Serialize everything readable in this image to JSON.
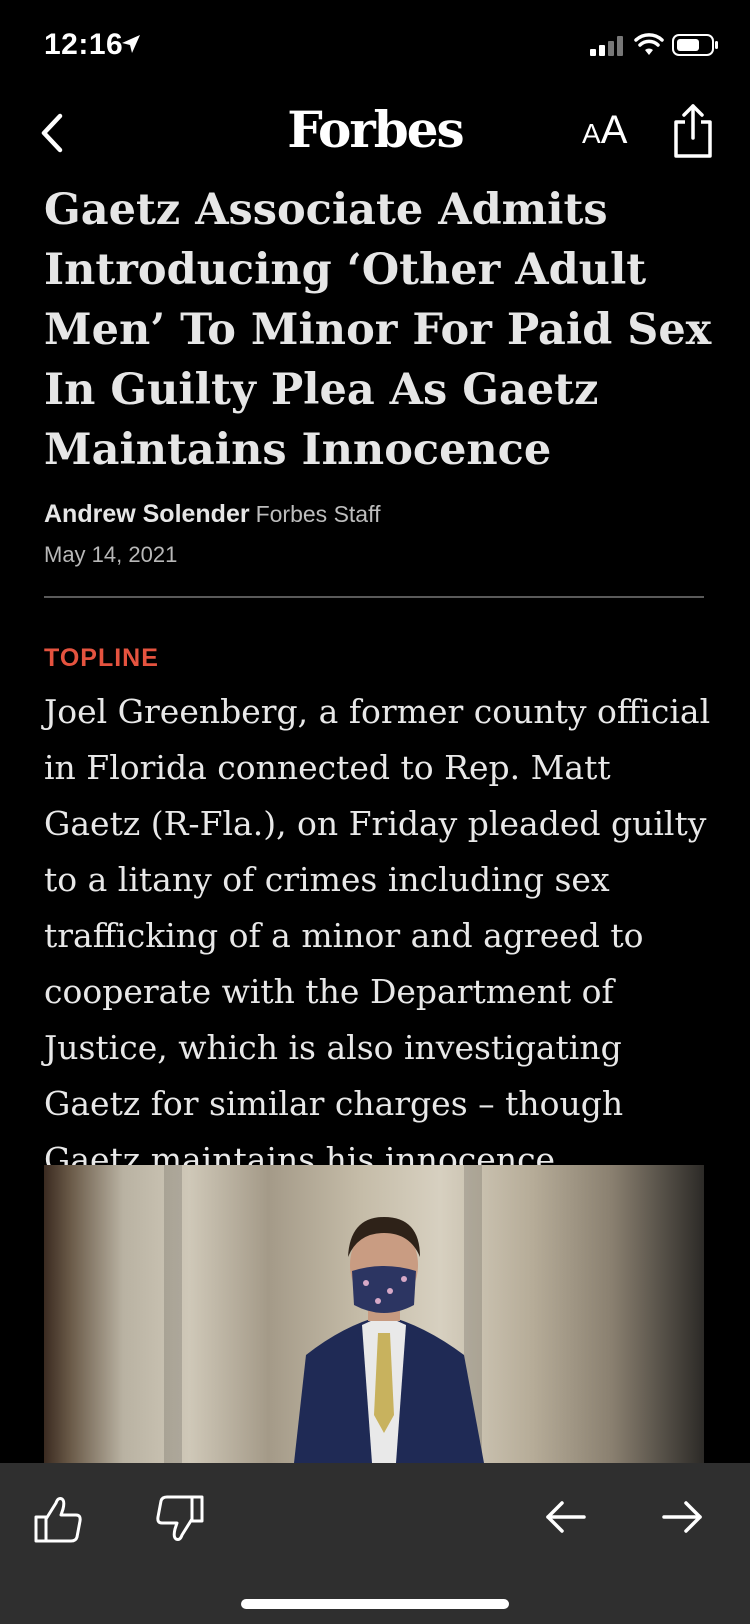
{
  "status_bar": {
    "time": "12:16",
    "icons": [
      "location-arrow-icon",
      "signal-icon",
      "wifi-icon",
      "battery-icon"
    ]
  },
  "nav": {
    "back_icon": "chevron-left-icon",
    "brand": "Forbes",
    "text_size_small": "A",
    "text_size_large": "A",
    "share_icon": "share-icon"
  },
  "article": {
    "headline": "Gaetz Associate Admits Introducing ‘Other Adult Men’ To Minor For Paid Sex In Guilty Plea As Gaetz Maintains Innocence",
    "author": "Andrew Solender",
    "author_role": "Forbes Staff",
    "date": "May 14, 2021",
    "section_label": "TOPLINE",
    "topline": "Joel Greenberg, a former county official in Florida connected to Rep. Matt Gaetz (R-Fla.), on Friday pleaded guilty to a litany of crimes including sex trafficking of a minor and agreed to cooperate with the Department of Justice, which is also investigating Gaetz for similar charges – though Gaetz maintains his innocence."
  },
  "colors": {
    "background": "#000000",
    "accent": "#e5533f",
    "toolbar": "#2f2f2f"
  },
  "toolbar": {
    "icons": [
      "thumbs-up-icon",
      "thumbs-down-icon",
      "arrow-left-icon",
      "arrow-right-icon"
    ]
  }
}
